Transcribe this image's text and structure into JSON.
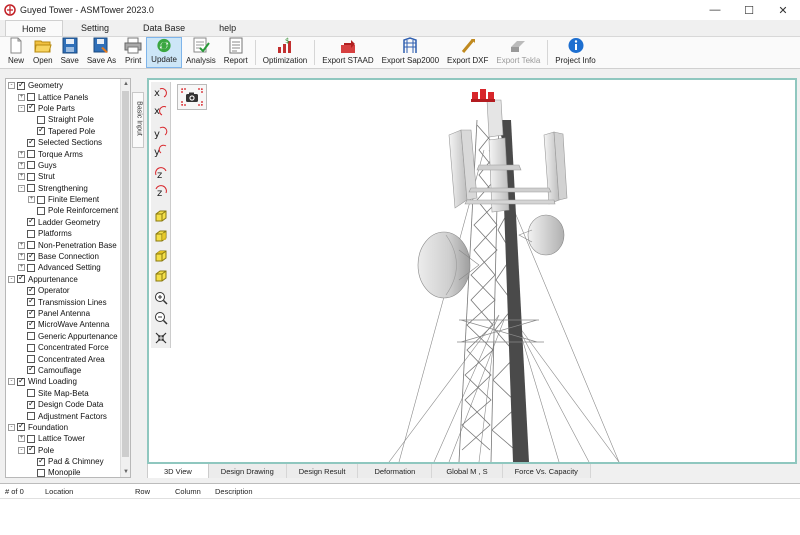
{
  "window": {
    "title": "Guyed Tower - ASMTower 2023.0",
    "minimize": "—",
    "maximize": "☐",
    "close": "✕"
  },
  "tabs": [
    {
      "label": "Home",
      "active": true
    },
    {
      "label": "Setting"
    },
    {
      "label": "Data Base"
    },
    {
      "label": "help"
    }
  ],
  "toolbar": [
    {
      "label": "New",
      "icon": "new-file-icon"
    },
    {
      "label": "Open",
      "icon": "folder-open-icon"
    },
    {
      "label": "Save",
      "icon": "save-icon"
    },
    {
      "label": "Save As",
      "icon": "save-as-icon"
    },
    {
      "label": "Print",
      "icon": "print-icon"
    },
    {
      "label": "Update",
      "icon": "refresh-icon",
      "active": true
    },
    {
      "label": "Analysis",
      "icon": "analysis-icon"
    },
    {
      "label": "Report",
      "icon": "report-icon"
    },
    {
      "label": "Optimization",
      "icon": "optimization-icon"
    },
    {
      "label": "Export STAAD",
      "icon": "export-staad-icon"
    },
    {
      "label": "Export Sap2000",
      "icon": "export-sap-icon"
    },
    {
      "label": "Export DXF",
      "icon": "export-dxf-icon"
    },
    {
      "label": "Export Tekla",
      "icon": "export-tekla-icon",
      "disabled": true
    },
    {
      "label": "Project Info",
      "icon": "info-icon"
    }
  ],
  "side_tab": "Basic Input",
  "tree": [
    {
      "label": "Geometry",
      "level": 0,
      "expander": "-",
      "checked": true
    },
    {
      "label": "Lattice Panels",
      "level": 1,
      "expander": "+",
      "checked": false
    },
    {
      "label": "Pole Parts",
      "level": 1,
      "expander": "-",
      "checked": true
    },
    {
      "label": "Straight Pole",
      "level": 2,
      "checked": false
    },
    {
      "label": "Tapered Pole",
      "level": 2,
      "checked": true
    },
    {
      "label": "Selected Sections",
      "level": 1,
      "checked": true
    },
    {
      "label": "Torque Arms",
      "level": 1,
      "expander": "+",
      "checked": false
    },
    {
      "label": "Guys",
      "level": 1,
      "expander": "+",
      "checked": false
    },
    {
      "label": "Strut",
      "level": 1,
      "expander": "+",
      "checked": false
    },
    {
      "label": "Strengthening",
      "level": 1,
      "expander": "-",
      "checked": false
    },
    {
      "label": "Finite Element",
      "level": 2,
      "expander": "+",
      "checked": false
    },
    {
      "label": "Pole Reinforcement",
      "level": 2,
      "checked": false
    },
    {
      "label": "Ladder Geometry",
      "level": 1,
      "checked": true
    },
    {
      "label": "Platforms",
      "level": 1,
      "checked": false
    },
    {
      "label": "Non-Penetration Base",
      "level": 1,
      "expander": "+",
      "checked": false
    },
    {
      "label": "Base Connection",
      "level": 1,
      "expander": "+",
      "checked": true
    },
    {
      "label": "Advanced Setting",
      "level": 1,
      "expander": "+",
      "checked": false
    },
    {
      "label": "Appurtenance",
      "level": 0,
      "expander": "-",
      "checked": true
    },
    {
      "label": "Operator",
      "level": 1,
      "checked": true
    },
    {
      "label": "Transmission Lines",
      "level": 1,
      "checked": true
    },
    {
      "label": "Panel Antenna",
      "level": 1,
      "checked": true
    },
    {
      "label": "MicroWave Antenna",
      "level": 1,
      "checked": true
    },
    {
      "label": "Generic Appurtenance",
      "level": 1,
      "checked": false
    },
    {
      "label": "Concentrated Force",
      "level": 1,
      "checked": false
    },
    {
      "label": "Concentrated Area",
      "level": 1,
      "checked": false
    },
    {
      "label": "Camouflage",
      "level": 1,
      "checked": true
    },
    {
      "label": "Wind Loading",
      "level": 0,
      "expander": "-",
      "checked": true
    },
    {
      "label": "Site Map-Beta",
      "level": 1,
      "checked": false
    },
    {
      "label": "Design Code Data",
      "level": 1,
      "checked": true
    },
    {
      "label": "Adjustment Factors",
      "level": 1,
      "checked": false
    },
    {
      "label": "Foundation",
      "level": 0,
      "expander": "-",
      "checked": true
    },
    {
      "label": "Lattice Tower",
      "level": 1,
      "expander": "+",
      "checked": false
    },
    {
      "label": "Pole",
      "level": 1,
      "expander": "-",
      "checked": true
    },
    {
      "label": "Pad & Chimney",
      "level": 2,
      "checked": true
    },
    {
      "label": "Monopile",
      "level": 2,
      "checked": false
    }
  ],
  "view_tools": [
    "x-axis-rotate-ccw-icon",
    "x-axis-rotate-cw-icon",
    "y-axis-rotate-ccw-icon",
    "y-axis-rotate-cw-icon",
    "z-axis-rotate-ccw-icon",
    "z-axis-rotate-cw-icon",
    "cube-view-front-icon",
    "cube-view-side-icon",
    "cube-view-top-icon",
    "cube-view-iso-icon",
    "zoom-in-icon",
    "zoom-out-icon",
    "fit-to-view-icon"
  ],
  "bottom_tabs": [
    {
      "label": "3D View",
      "active": true
    },
    {
      "label": "Design Drawing"
    },
    {
      "label": "Design Result"
    },
    {
      "label": "Deformation"
    },
    {
      "label": "Global M , S"
    },
    {
      "label": "Force Vs. Capacity"
    }
  ],
  "results_table": {
    "columns": [
      "# of 0",
      "Location",
      "Row",
      "Column",
      "Description"
    ]
  },
  "colors": {
    "viewport_border": "#8fc7bf",
    "active_button": "#cde6f7",
    "tower_red": "#d8262b"
  }
}
